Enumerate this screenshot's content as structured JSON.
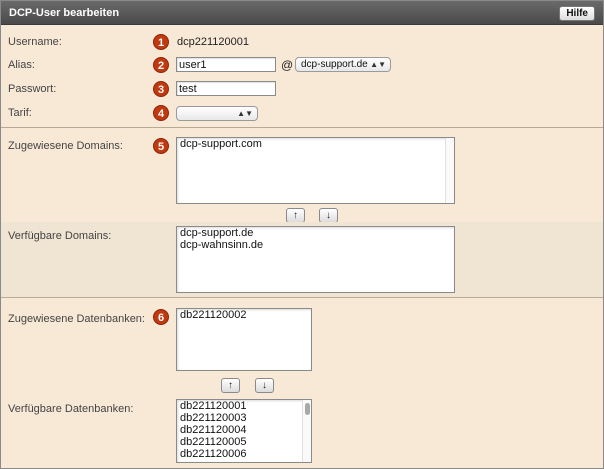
{
  "window": {
    "title": "DCP-User bearbeiten",
    "help_label": "Hilfe"
  },
  "form": {
    "username": {
      "label": "Username:",
      "badge": "1",
      "value": "dcp221120001"
    },
    "alias": {
      "label": "Alias:",
      "badge": "2",
      "value": "user1",
      "at": "@",
      "domain_selected": "dcp-support.de"
    },
    "passwort": {
      "label": "Passwort:",
      "badge": "3",
      "value": "test"
    },
    "tarif": {
      "label": "Tarif:",
      "badge": "4",
      "selected": ""
    }
  },
  "domains": {
    "assigned_label": "Zugewiesene Domains:",
    "badge": "5",
    "assigned": [
      "dcp-support.com"
    ],
    "available_label": "Verfügbare Domains:",
    "available": [
      "dcp-support.de",
      "dcp-wahnsinn.de"
    ],
    "up_icon": "↑",
    "down_icon": "↓"
  },
  "databases": {
    "assigned_label": "Zugewiesene Datenbanken:",
    "badge": "6",
    "assigned": [
      "db221120002"
    ],
    "available_label": "Verfügbare Datenbanken:",
    "available": [
      "db221120001",
      "db221120003",
      "db221120004",
      "db221120005",
      "db221120006"
    ],
    "up_icon": "↑",
    "down_icon": "↓"
  },
  "colors": {
    "accent_badge": "#c0390f",
    "panel_bg": "#f8e9d6",
    "titlebar": "#555555"
  }
}
